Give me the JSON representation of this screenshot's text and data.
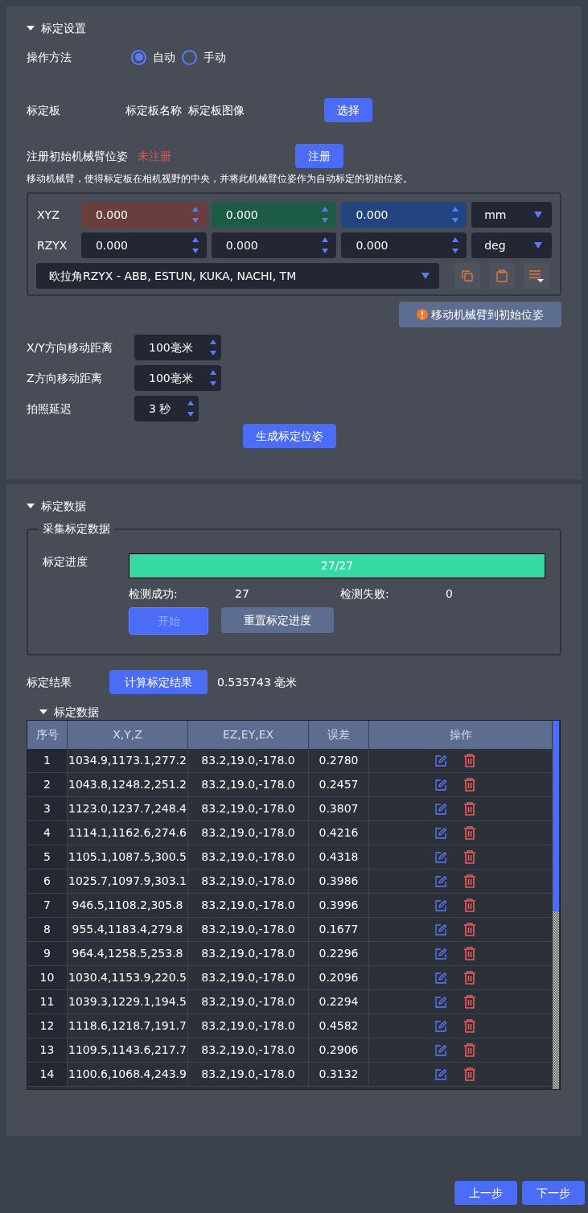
{
  "settings": {
    "title": "标定设置",
    "expanded": true,
    "method": {
      "label": "操作方法",
      "options": [
        {
          "label": "自动",
          "selected": true
        },
        {
          "label": "手动",
          "selected": false
        }
      ]
    },
    "board": {
      "label": "标定板",
      "name": "标定板名称",
      "image": "标定板图像",
      "button": "选择"
    },
    "register": {
      "label": "注册初始机械臂位姿",
      "status": "未注册",
      "button": "注册",
      "hint": "移动机械臂，使得标定板在相机视野的中央，并将此机械臂位姿作为自动标定的初始位姿。"
    },
    "pose": {
      "rows": [
        {
          "label": "XYZ",
          "unit": "mm",
          "values": [
            {
              "value": "0.000",
              "color": "#6b3e3e"
            },
            {
              "value": "0.000",
              "color": "#1c5c45"
            },
            {
              "value": "0.000",
              "color": "#22457f"
            }
          ]
        },
        {
          "label": "RZYX",
          "unit": "deg",
          "values": [
            {
              "value": "0.000"
            },
            {
              "value": "0.000"
            },
            {
              "value": "0.000"
            }
          ]
        }
      ],
      "convention": "欧拉角RZYX - ABB, ESTUN, KUKA, NACHI, TM"
    },
    "move_button": "移动机械臂到初始位姿",
    "params": [
      {
        "label": "X/Y方向移动距离",
        "value": "100毫米"
      },
      {
        "label": "Z方向移动距离",
        "value": "100毫米"
      },
      {
        "label": "拍照延迟",
        "value": "3 秒"
      }
    ],
    "generate_button": "生成标定位姿"
  },
  "data": {
    "title": "标定数据",
    "expanded": true,
    "collect": {
      "legend": "采集标定数据",
      "progress_label": "标定进度",
      "level": 1,
      "progress_text": "27/27",
      "success_label": "检测成功:",
      "success": "27",
      "fail_label": "检测失败:",
      "fail": "0",
      "start": {
        "label": "开始",
        "disabled": true
      },
      "reset": {
        "label": "重置标定进度",
        "disabled": false
      }
    },
    "result": {
      "label": "标定结果",
      "button": "计算标定结果",
      "value": "0.535743 毫米"
    },
    "table": {
      "title": "标定数据",
      "expanded": true,
      "columns": [
        "序号",
        "X,Y,Z",
        "EZ,EY,EX",
        "误差",
        "操作"
      ],
      "rows": [
        [
          "1",
          "1034.9,1173.1,277.2",
          "83.2,19.0,-178.0",
          "0.2780"
        ],
        [
          "2",
          "1043.8,1248.2,251.2",
          "83.2,19.0,-178.0",
          "0.2457"
        ],
        [
          "3",
          "1123.0,1237.7,248.4",
          "83.2,19.0,-178.0",
          "0.3807"
        ],
        [
          "4",
          "1114.1,1162.6,274.6",
          "83.2,19.0,-178.0",
          "0.4216"
        ],
        [
          "5",
          "1105.1,1087.5,300.5",
          "83.2,19.0,-178.0",
          "0.4318"
        ],
        [
          "6",
          "1025.7,1097.9,303.1",
          "83.2,19.0,-178.0",
          "0.3986"
        ],
        [
          "7",
          "946.5,1108.2,305.8",
          "83.2,19.0,-178.0",
          "0.3996"
        ],
        [
          "8",
          "955.4,1183.4,279.8",
          "83.2,19.0,-178.0",
          "0.1677"
        ],
        [
          "9",
          "964.4,1258.5,253.8",
          "83.2,19.0,-178.0",
          "0.2296"
        ],
        [
          "10",
          "1030.4,1153.9,220.5",
          "83.2,19.0,-178.0",
          "0.2096"
        ],
        [
          "11",
          "1039.3,1229.1,194.5",
          "83.2,19.0,-178.0",
          "0.2294"
        ],
        [
          "12",
          "1118.6,1218.7,191.7",
          "83.2,19.0,-178.0",
          "0.4582"
        ],
        [
          "13",
          "1109.5,1143.6,217.7",
          "83.2,19.0,-178.0",
          "0.2906"
        ],
        [
          "14",
          "1100.6,1068.4,243.9",
          "83.2,19.0,-178.0",
          "0.3132"
        ]
      ]
    }
  },
  "nav": {
    "prev": "上一步",
    "next": "下一步"
  }
}
